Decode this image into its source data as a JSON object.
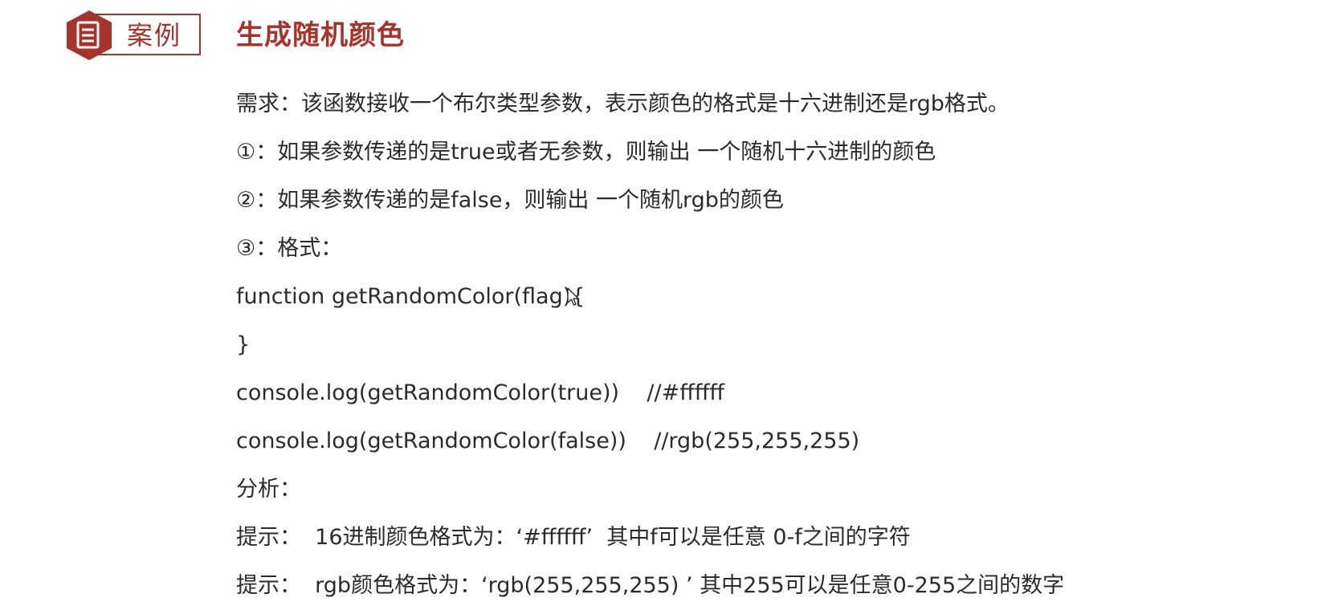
{
  "badge": {
    "label": "案例",
    "icon": "document-icon",
    "color": "#a8332a"
  },
  "title": "生成随机颜色",
  "lines": [
    "需求：该函数接收一个布尔类型参数，表示颜色的格式是十六进制还是rgb格式。",
    "①：如果参数传递的是true或者无参数，则输出 一个随机十六进制的颜色",
    "②：如果参数传递的是false，则输出 一个随机rgb的颜色",
    "③：格式：",
    "function getRandomColor(flag){",
    "}",
    "console.log(getRandomColor(true))    //#ffffff",
    "console.log(getRandomColor(false))    //rgb(255,255,255)",
    "分析：",
    "提示：  16进制颜色格式为：‘#ffffff’  其中f可以是任意 0-f之间的字符",
    "提示：  rgb颜色格式为：‘rgb(255,255,255) ’ 其中255可以是任意0-255之间的数字"
  ]
}
